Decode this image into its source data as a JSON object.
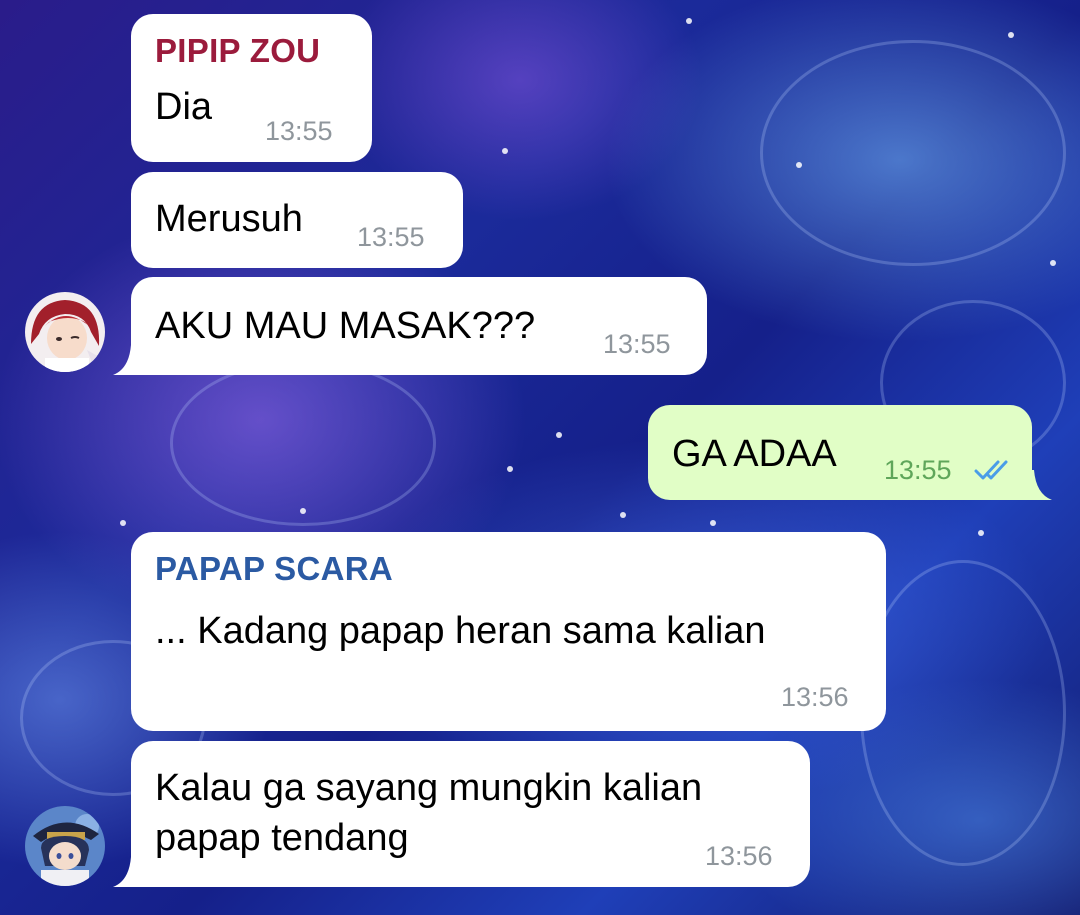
{
  "colors": {
    "incoming_bubble": "#ffffff",
    "outgoing_bubble": "#e1fec6",
    "sender_pipip": "#9b1b3c",
    "sender_papap": "#2b5aa3",
    "timestamp": "#8f969c",
    "read_check": "#4a9de8"
  },
  "messages": [
    {
      "sender": "PIPIP ZOU",
      "text": "Dia",
      "time": "13:55"
    },
    {
      "text": "Merusuh",
      "time": "13:55"
    },
    {
      "text": "AKU MAU MASAK???",
      "time": "13:55"
    },
    {
      "text": "GA ADAA",
      "time": "13:55",
      "status": "read"
    },
    {
      "sender": "PAPAP SCARA",
      "text": "... Kadang papap heran sama kalian",
      "time": "13:56"
    },
    {
      "text_line1": "Kalau ga sayang mungkin kalian",
      "text_line2": "papap tendang",
      "time": "13:56"
    }
  ],
  "avatars": {
    "pipip": "red-haired-avatar-icon",
    "papap": "dark-haired-hat-avatar-icon"
  }
}
